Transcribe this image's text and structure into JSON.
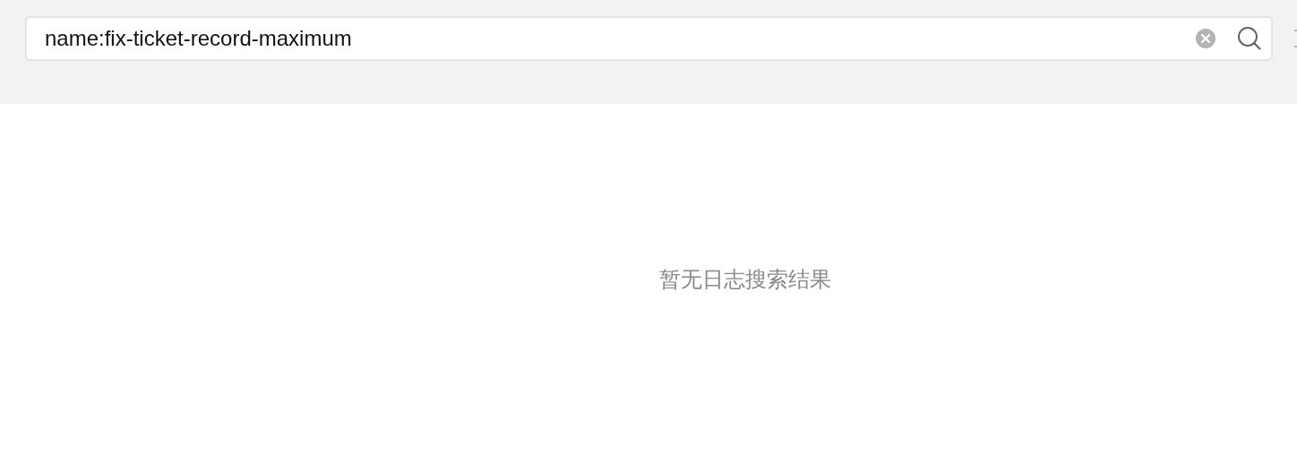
{
  "search": {
    "value": "name:fix-ticket-record-maximum"
  },
  "empty_message": "暂无日志搜索结果"
}
